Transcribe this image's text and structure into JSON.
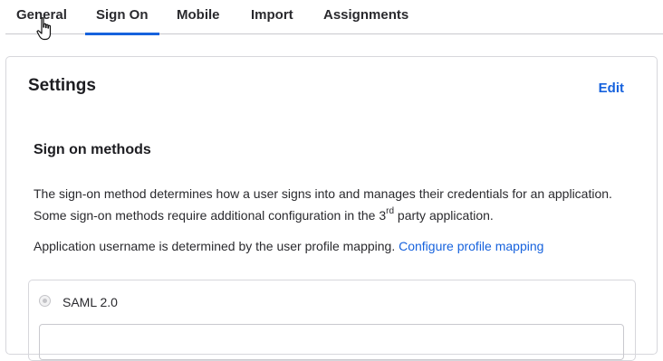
{
  "tabs": [
    {
      "label": "General",
      "active": false
    },
    {
      "label": "Sign On",
      "active": true
    },
    {
      "label": "Mobile",
      "active": false
    },
    {
      "label": "Import",
      "active": false
    },
    {
      "label": "Assignments",
      "active": false
    }
  ],
  "settings": {
    "title": "Settings",
    "edit_label": "Edit"
  },
  "sign_on_methods": {
    "title": "Sign on methods",
    "description_part1": "The sign-on method determines how a user signs into and manages their credentials for an application. Some sign-on methods require additional configuration in the 3",
    "description_sup": "rd",
    "description_part2": " party application.",
    "mapping_text": "Application username is determined by the user profile mapping.",
    "mapping_link": "Configure profile mapping"
  },
  "methods": [
    {
      "label": "SAML 2.0",
      "selected": false
    }
  ],
  "colors": {
    "accent": "#1662dd",
    "text": "#1d1d21",
    "border": "#d7d7dc"
  },
  "icons": {
    "cursor": "hand-pointer-icon"
  }
}
